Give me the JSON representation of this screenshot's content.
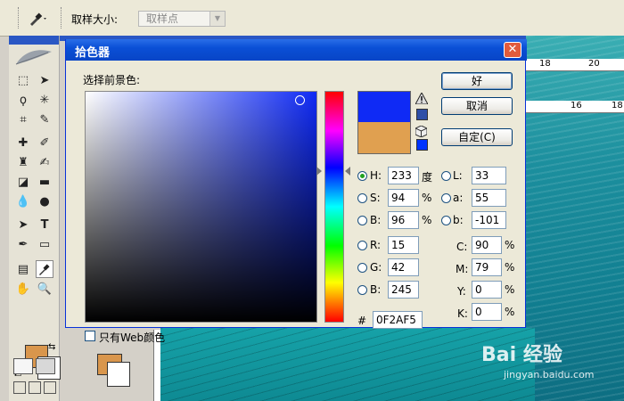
{
  "options_bar": {
    "sample_size_label": "取样大小:",
    "sample_size_value": "取样点"
  },
  "dialog": {
    "title": "拾色器",
    "prompt": "选择前景色:",
    "buttons": {
      "ok": "好",
      "cancel": "取消",
      "custom": "自定(C)"
    },
    "hsb": [
      {
        "label": "H:",
        "value": "233",
        "unit": "度",
        "checked": true
      },
      {
        "label": "S:",
        "value": "94",
        "unit": "%",
        "checked": false
      },
      {
        "label": "B:",
        "value": "96",
        "unit": "%",
        "checked": false
      }
    ],
    "rgb": [
      {
        "label": "R:",
        "value": "15"
      },
      {
        "label": "G:",
        "value": "42"
      },
      {
        "label": "B:",
        "value": "245"
      }
    ],
    "lab": [
      {
        "label": "L:",
        "value": "33"
      },
      {
        "label": "a:",
        "value": "55"
      },
      {
        "label": "b:",
        "value": "-101"
      }
    ],
    "cmyk": [
      {
        "label": "C:",
        "value": "90",
        "unit": "%"
      },
      {
        "label": "M:",
        "value": "79",
        "unit": "%"
      },
      {
        "label": "Y:",
        "value": "0",
        "unit": "%"
      },
      {
        "label": "K:",
        "value": "0",
        "unit": "%"
      }
    ],
    "hex_label": "#",
    "hex_value": "0F2AF5",
    "web_only_label": "只有Web颜色",
    "new_color": "#0F2AF5",
    "old_color": "#E0A050"
  },
  "toolbox": {
    "foreground_color": "#D9964C",
    "background_color": "#FFFFFF"
  },
  "rulers": {
    "top_marks": [
      "18",
      "20"
    ],
    "second_marks": [
      "16",
      "18"
    ]
  },
  "watermark": {
    "main": "Bai 经验",
    "sub": "jingyan.baidu.com"
  }
}
